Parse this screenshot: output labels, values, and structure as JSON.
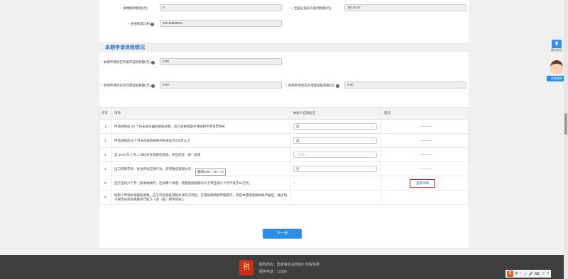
{
  "fields": {
    "row1": {
      "label1": "解缴税款税额(元)",
      "value1": "0",
      "label2": "全部已抵扣的进项税额(元)",
      "value2": "25716.07"
    },
    "row2": {
      "label": "进项构成比例",
      "value": "100.000000%"
    },
    "section_title": "本期申请退税情况",
    "row3": {
      "label": "本期申请退还的期末留抵税额(元)",
      "value": "0.00"
    },
    "row4": {
      "label1": "本期申请退还的存量留抵税额(元)",
      "value1": "0.00",
      "label2": "本期申请退还的增量留抵税额(元)",
      "value2": "0.00"
    }
  },
  "table": {
    "headers": [
      "序号",
      "项目",
      "纳税人自我报告",
      "操作"
    ],
    "rows": [
      {
        "idx": "1",
        "item": "申请退税前 36 个月未发生骗取留抵退税、出口退税或虚开增值税专用发票情形",
        "choice": "是",
        "op": "————"
      },
      {
        "idx": "2",
        "item": "申请退税前36个月未因偷税被税务机关处罚2次及以上",
        "choice": "是",
        "op": "————"
      },
      {
        "idx": "3",
        "item": "自 2019 年 4 月 1 日起未享受即征即退、先征后返（退）政策",
        "choice": "--选择--",
        "op": "————"
      },
      {
        "idx": "4",
        "item": "出口货物劳务、发生跨境应税行为，适用免抵退税办法",
        "choice": "否",
        "op": "————"
      },
      {
        "idx": "5",
        "item": "是否连续六个月（按季纳税的，连续两个季度）增量留抵税额均大于零且第六个月不低于50万元。",
        "choice": "--",
        "op": "查看详情"
      },
      {
        "idx": "6",
        "item": "纳税人申请办理留抵退税，应于符合留抵退税条件的次月起，在增值税纳税申报期内，完成本期增值税纳税申报后，通过电子税务局或办税服务厅提交《退（抵）税申请表》。",
        "choice": "",
        "op": ""
      }
    ],
    "tooltip": "截图(Ctrl + Alt + A)"
  },
  "next_label": "下一步",
  "footer": {
    "copyright": "版权所有：国家税务总局四川省税务局",
    "phone": "服务电话：12366"
  },
  "side": {
    "ops_label": "操作指引",
    "cs_label": "在线咨询"
  },
  "tray": [
    "S",
    "中",
    "°,",
    "☺",
    "🎤",
    "⌨",
    "👕",
    "⠿"
  ]
}
